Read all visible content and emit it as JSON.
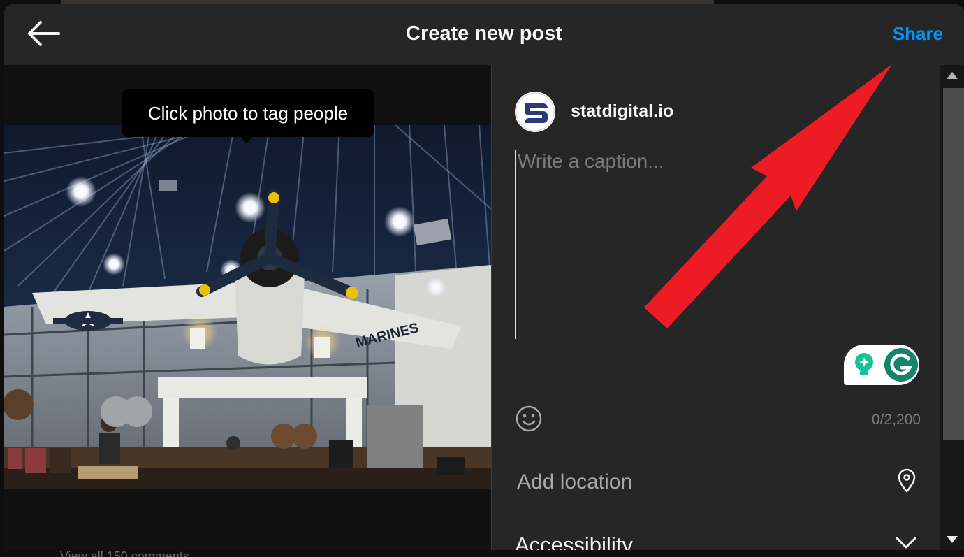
{
  "header": {
    "title": "Create new post",
    "share_label": "Share",
    "back_icon": "arrow-left-icon"
  },
  "photo": {
    "tooltip": "Click photo to tag people",
    "marking_text": "MARINES"
  },
  "details": {
    "username": "statdigital.io",
    "caption_placeholder": "Write a caption...",
    "char_count": "0/2,200",
    "location_label": "Add location",
    "accessibility_label": "Accessibility"
  },
  "backdrop": {
    "partial_text": "View all 150 comments"
  },
  "colors": {
    "accent": "#0095f6",
    "panel": "#262626",
    "arrow": "#ed1c24",
    "grammarly": "#15846b"
  },
  "icons": {
    "emoji": "smiley-icon",
    "location": "map-pin-icon",
    "accessibility": "chevron-down-icon",
    "grammarly": "grammarly-icon",
    "bulb": "lightbulb-icon"
  }
}
